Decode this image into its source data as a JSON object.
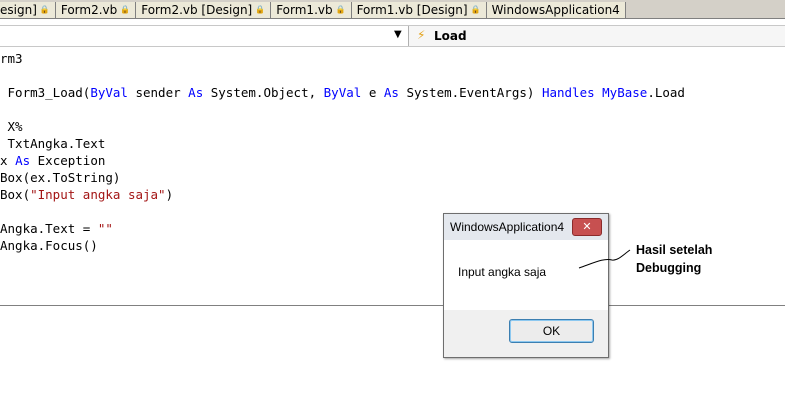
{
  "tabs": [
    {
      "label": "esign]",
      "locked": true,
      "active": false
    },
    {
      "label": "Form2.vb",
      "locked": true,
      "active": false
    },
    {
      "label": "Form2.vb [Design]",
      "locked": true,
      "active": false
    },
    {
      "label": "Form1.vb",
      "locked": true,
      "active": false
    },
    {
      "label": "Form1.vb [Design]",
      "locked": true,
      "active": false
    },
    {
      "label": "WindowsApplication4",
      "locked": false,
      "active": false
    }
  ],
  "lock_glyph": "🔒",
  "member_bar": {
    "left_value": "",
    "arrow_glyph": "▼",
    "event_icon": "⚡",
    "right_value": "Load"
  },
  "code": {
    "line1": {
      "t": "rm3"
    },
    "line2": {
      "a": " Form3_Load(",
      "k1": "ByVal",
      "b": " sender ",
      "k2": "As",
      "c": " System.Object, ",
      "k3": "ByVal",
      "d": " e ",
      "k4": "As",
      "e": " System.EventArgs) ",
      "k5": "Handles",
      "f": " ",
      "k6": "MyBase",
      "g": ".Load"
    },
    "line3": {
      "t": " X%"
    },
    "line4": {
      "t": " TxtAngka.Text"
    },
    "line5": {
      "a": "x ",
      "k1": "As",
      "b": " Exception"
    },
    "line6": {
      "t": "Box(ex.ToString)"
    },
    "line7": {
      "a": "Box(",
      "s": "\"Input angka saja\"",
      "b": ")"
    },
    "line8": {
      "a": "Angka.Text = ",
      "s": "\"\""
    },
    "line9": {
      "t": "Angka.Focus()"
    }
  },
  "dialog": {
    "title": "WindowsApplication4",
    "close_glyph": "✕",
    "message": "Input angka saja",
    "ok_label": "OK"
  },
  "annotation": {
    "line1": "Hasil setelah",
    "line2": "Debugging"
  },
  "colors": {
    "keyword": "#0000ff",
    "string": "#a31515",
    "close_button": "#c75050",
    "ok_border": "#3c7fb1"
  }
}
